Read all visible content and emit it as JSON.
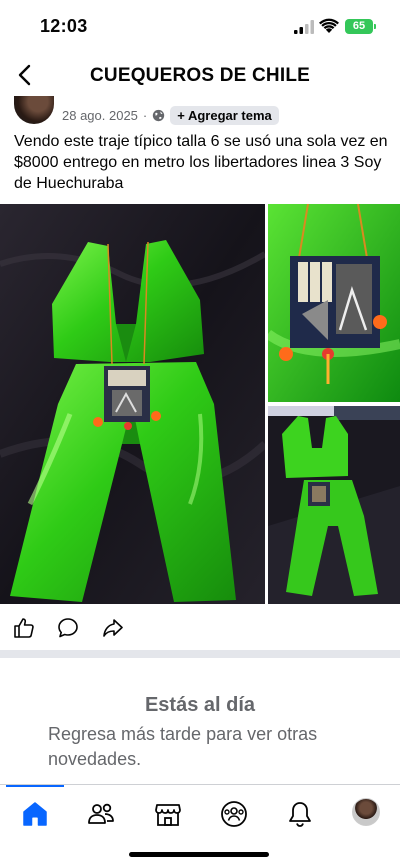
{
  "status_bar": {
    "time": "12:03",
    "battery": "65"
  },
  "header": {
    "title": "CUEQUEROS DE CHILE",
    "back_icon": "chevron-left-icon"
  },
  "post": {
    "date": "28 ago. 2025",
    "separator": "·",
    "visibility_icon": "globe-icon",
    "add_topic_label": "+ Agregar tema",
    "text": "Vendo este traje típico talla 6 se usó una sola vez en $8000 entrego en metro los libertadores linea 3 Soy de Huechuraba",
    "photos": [
      "green-satin-costume-full",
      "costume-detail-pouch",
      "costume-on-floor"
    ],
    "actions": [
      "like-icon",
      "comment-icon",
      "share-icon"
    ]
  },
  "caught_up": {
    "title": "Estás al día",
    "subtitle": "Regresa más tarde para ver otras novedades."
  },
  "tab_bar": {
    "tabs": [
      "home-icon",
      "friends-icon",
      "marketplace-icon",
      "groups-icon",
      "notifications-icon",
      "profile-avatar"
    ],
    "active": "home-icon",
    "accent_color": "#0866ff"
  },
  "colors": {
    "muted_text": "#65676b",
    "costume_green": "#3cd41e",
    "battery_green": "#34c759"
  }
}
